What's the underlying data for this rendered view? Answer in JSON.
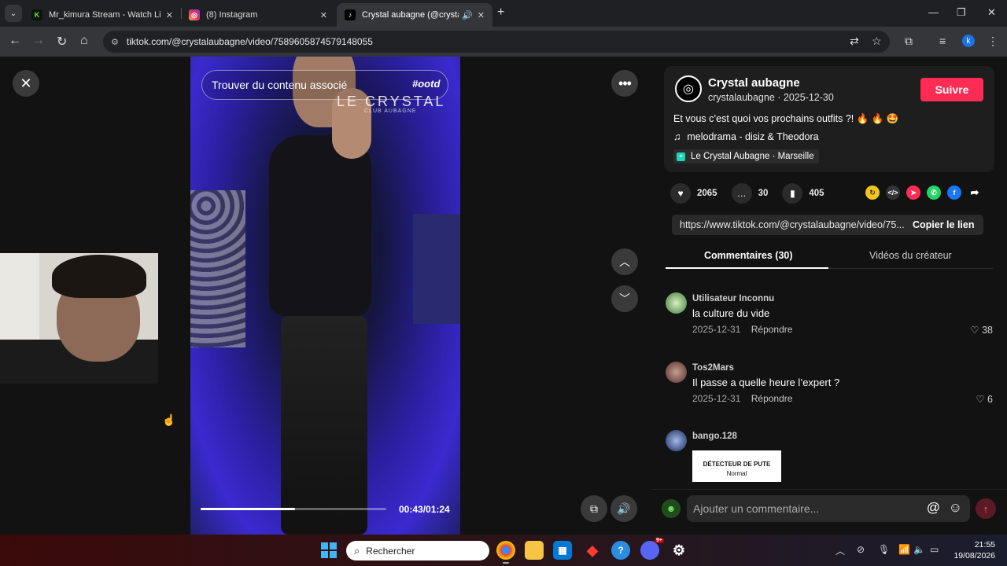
{
  "browser": {
    "tabs": [
      {
        "title": "Mr_kimura Stream - Watch Live",
        "active": false
      },
      {
        "title": "(8) Instagram",
        "active": false
      },
      {
        "title": "Crystal aubagne (@crystala",
        "active": true
      }
    ],
    "url": "tiktok.com/@crystalaubagne/video/7589605874579148055",
    "profile_initial": "k"
  },
  "video": {
    "suggest_label": "Trouver du contenu associé",
    "watermark": "LE CRYSTAL",
    "watermark_sub": "CLUB AUBAGNE",
    "sticker": "#ootd",
    "time": "00:43/01:24",
    "progress": 0.51
  },
  "author": {
    "name": "Crystal aubagne",
    "handle_date": "crystalaubagne · 2025-12-30",
    "follow_label": "Suivre"
  },
  "post": {
    "caption": "Et vous c’est quoi vos prochains outfits ?! 🔥 🔥 🤩",
    "music": "melodrama - disiz & Theodora",
    "location": "Le Crystal Aubagne · Marseille"
  },
  "stats": {
    "likes": "2065",
    "comments": "30",
    "saves": "405"
  },
  "share": {
    "link": "https://www.tiktok.com/@crystalaubagne/video/75...",
    "copy_label": "Copier le lien"
  },
  "tabs": {
    "comments": "Commentaires (30)",
    "creator_videos": "Vidéos du créateur"
  },
  "comments": [
    {
      "user": "Utilisateur Inconnu",
      "text": "la culture du vide",
      "date": "2025-12-31",
      "reply": "Répondre",
      "likes": "38"
    },
    {
      "user": "Tos2Mars",
      "text": "Il passe a quelle heure l’expert ?",
      "date": "2025-12-31",
      "reply": "Répondre",
      "likes": "6"
    },
    {
      "user": "bango.128",
      "image_text": "DÉTECTEUR DE PUTE",
      "image_sub": "Normal"
    }
  ],
  "composer": {
    "placeholder": "Ajouter un commentaire..."
  },
  "taskbar": {
    "search": "Rechercher",
    "time": "21:55",
    "date": "19/08/2026",
    "discord_badge": "9+"
  },
  "colors": {
    "follow": "#fe2c55",
    "page_bg": "#121212"
  }
}
